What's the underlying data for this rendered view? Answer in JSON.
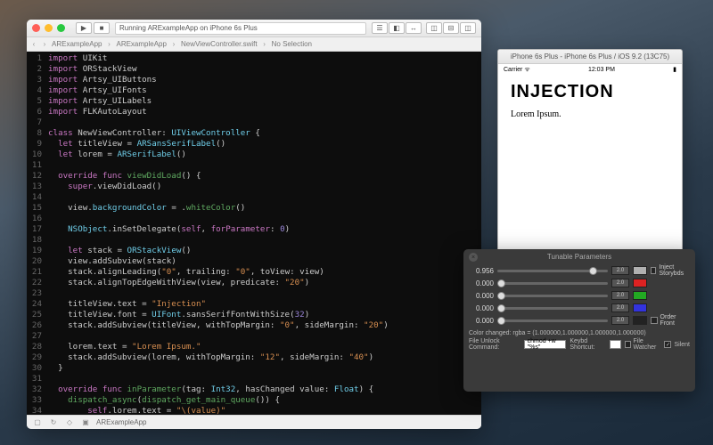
{
  "xcode": {
    "status": "Running ARExampleApp on iPhone 6s Plus",
    "breadcrumb": [
      "ARExampleApp",
      "ARExampleApp",
      "NewViewController.swift",
      "No Selection"
    ],
    "bottombar": {
      "project": "ARExampleApp"
    },
    "code": {
      "l1": "import",
      "l1b": " UIKit",
      "l2": "import",
      "l2b": " ORStackView",
      "l3": "import",
      "l3b": " Artsy_UIButtons",
      "l4": "import",
      "l4b": " Artsy_UIFonts",
      "l5": "import",
      "l5b": " Artsy_UILabels",
      "l6": "import",
      "l6b": " FLKAutoLayout",
      "l8a": "class",
      "l8b": " NewViewController: ",
      "l8c": "UIViewController",
      "l8d": " {",
      "l9a": "  let",
      "l9b": " titleView = ",
      "l9c": "ARSansSerifLabel",
      "l9d": "()",
      "l10a": "  let",
      "l10b": " lorem = ",
      "l10c": "ARSerifLabel",
      "l10d": "()",
      "l12a": "  override func",
      "l12b": " viewDidLoad",
      "l12c": "() {",
      "l13a": "    super",
      "l13b": ".viewDidLoad()",
      "l15a": "    view.",
      "l15b": "backgroundColor",
      "l15c": " = .",
      "l15d": "whiteColor",
      "l15e": "()",
      "l17a": "    NSObject",
      "l17b": ".inSetDelegate(",
      "l17c": "self",
      "l17d": ", ",
      "l17e": "forParameter",
      "l17f": ": ",
      "l17g": "0",
      "l17h": ")",
      "l19a": "    let",
      "l19b": " stack = ",
      "l19c": "ORStackView",
      "l19d": "()",
      "l20": "    view.addSubview(stack)",
      "l21a": "    stack.alignLeading(",
      "l21b": "\"0\"",
      "l21c": ", trailing: ",
      "l21d": "\"0\"",
      "l21e": ", toView: view)",
      "l22a": "    stack.alignTopEdgeWithView(view, predicate: ",
      "l22b": "\"20\"",
      "l22c": ")",
      "l24a": "    titleView.text = ",
      "l24b": "\"Injection\"",
      "l25a": "    titleView.font = ",
      "l25b": "UIFont",
      "l25c": ".sansSerifFontWithSize(",
      "l25d": "32",
      "l25e": ")",
      "l26a": "    stack.addSubview(titleView, withTopMargin: ",
      "l26b": "\"0\"",
      "l26c": ", sideMargin: ",
      "l26d": "\"20\"",
      "l26e": ")",
      "l28a": "    lorem.text = ",
      "l28b": "\"Lorem Ipsum.\"",
      "l29a": "    stack.addSubview(lorem, withTopMargin: ",
      "l29b": "\"12\"",
      "l29c": ", sideMargin: ",
      "l29d": "\"40\"",
      "l29e": ")",
      "l30": "  }",
      "l32a": "  override func",
      "l32b": " inParameter",
      "l32c": "(tag: ",
      "l32d": "Int32",
      "l32e": ", hasChanged value: ",
      "l32f": "Float",
      "l32g": ") {",
      "l33a": "    dispatch_async",
      "l33b": "(",
      "l33c": "dispatch_get_main_queue",
      "l33d": "()) {",
      "l34a": "        self",
      "l34b": ".lorem.text = ",
      "l34c": "\"\\(value)\"",
      "l35": "    }",
      "l36": "  }",
      "l37": "}"
    }
  },
  "simulator": {
    "title": "iPhone 6s Plus - iPhone 6s Plus / iOS 9.2 (13C75)",
    "carrier": "Carrier",
    "time": "12:03 PM",
    "heading": "INJECTION",
    "body": "Lorem Ipsum."
  },
  "tunable": {
    "title": "Tunable Parameters",
    "sliders": [
      {
        "value": "0.956",
        "pos": 83,
        "max": "2.0",
        "color": "#b0b0b0"
      },
      {
        "value": "0.000",
        "pos": 0,
        "max": "2.0",
        "color": "#d22"
      },
      {
        "value": "0.000",
        "pos": 0,
        "max": "2.0",
        "color": "#2a2"
      },
      {
        "value": "0.000",
        "pos": 0,
        "max": "2.0",
        "color": "#33d"
      },
      {
        "value": "0.000",
        "pos": 0,
        "max": "2.0",
        "color": "#222"
      }
    ],
    "checks": {
      "inject": "Inject Storybds",
      "order": "Order Front"
    },
    "color_line": "Color changed: rgba = (1.000000,1.000000,1.000000,1.000000)",
    "unlock_label": "File Unlock Command:",
    "unlock_value": "chmod +w \"%s\"",
    "keybd_label": "Keybd Shortcut:",
    "filewatcher": "File Watcher",
    "silent": "Silent"
  }
}
